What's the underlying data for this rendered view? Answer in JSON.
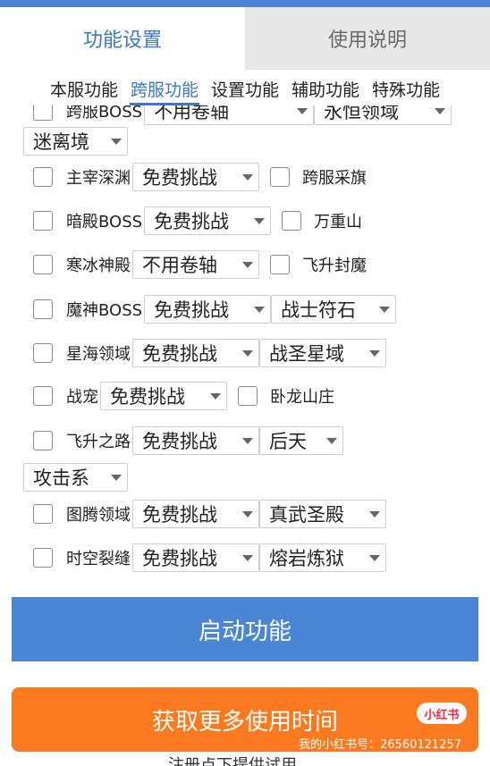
{
  "tabs": [
    {
      "label": "功能设置"
    },
    {
      "label": "使用说明"
    }
  ],
  "subtabs": [
    {
      "label": "本服功能"
    },
    {
      "label": "跨服功能"
    },
    {
      "label": "设置功能"
    },
    {
      "label": "辅助功能"
    },
    {
      "label": "特殊功能"
    }
  ],
  "items": {
    "partial_label": "跨服BOSS",
    "partial_sel1": "不用卷轴",
    "partial_sel2": "永恒领域",
    "region_select": "迷离境",
    "zhuzai_label": "主宰深渊",
    "zhuzai_sel": "免费挑战",
    "caiqi_label": "跨服采旗",
    "andian_label": "暗殿BOSS",
    "andian_sel": "免费挑战",
    "wanzhong_label": "万重山",
    "hanbing_label": "寒冰神殿",
    "hanbing_sel": "不用卷轴",
    "feisheng_fm_label": "飞升封魔",
    "moshen_label": "魔神BOSS",
    "moshen_sel": "免费挑战",
    "moshen_sel2": "战士符石",
    "xinghai_label": "星海领域",
    "xinghai_sel": "免费挑战",
    "xinghai_sel2": "战圣星域",
    "zhanchong_label": "战宠",
    "zhanchong_sel": "免费挑战",
    "wolong_label": "卧龙山庄",
    "feisheng_label": "飞升之路",
    "feisheng_sel": "免费挑战",
    "feisheng_sel2": "后天",
    "attack_select": "攻击系",
    "tuteng_label": "图腾领域",
    "tuteng_sel": "免费挑战",
    "tuteng_sel2": "真武圣殿",
    "shikong_label": "时空裂缝",
    "shikong_sel": "免费挑战",
    "shikong_sel2": "熔岩炼狱"
  },
  "buttons": {
    "start": "启动功能",
    "more_time": "获取更多使用时间"
  },
  "watermark": {
    "logo": "小红书",
    "text": "我的小红书号：26560121257"
  },
  "bottom_text": "注册点下提供试用"
}
